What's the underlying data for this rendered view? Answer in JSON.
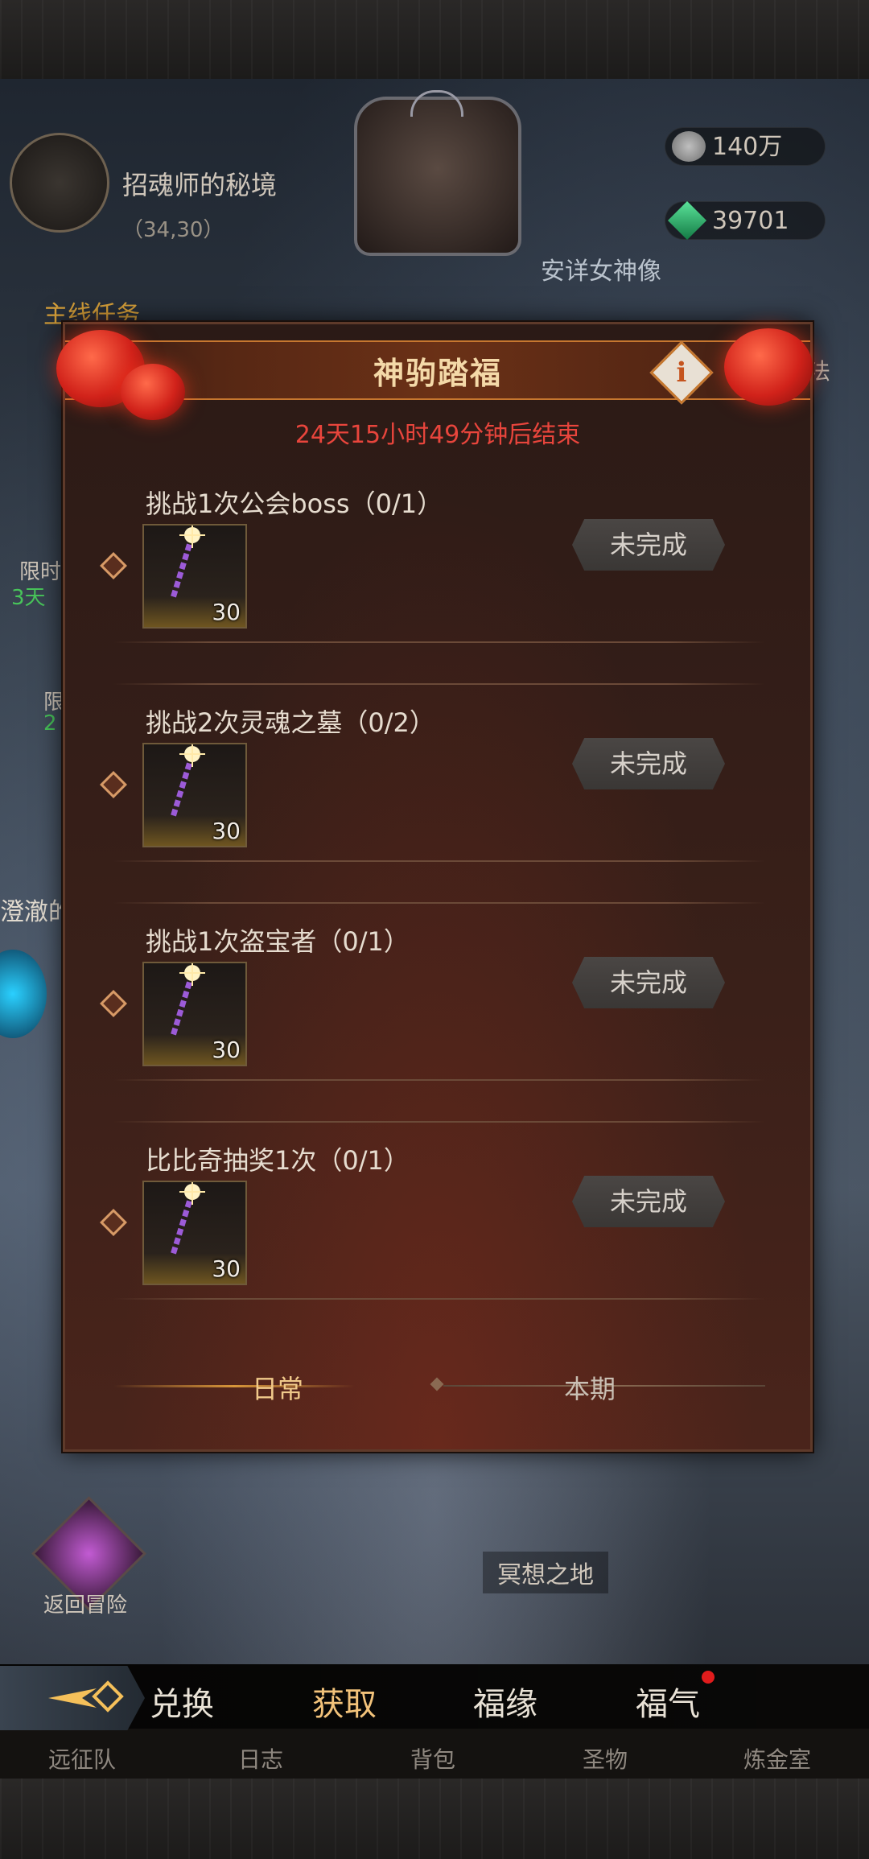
{
  "header": {
    "location_name": "招魂师的秘境",
    "coordinates": "（34,30）",
    "currency_silver": "140万",
    "currency_gem": "39701",
    "statue_label": "安详女神像"
  },
  "left_panel": {
    "quest_title": "主线任务",
    "timer_a": "限时",
    "timer_a_value": "3天",
    "timer_b": "限",
    "timer_b_value": "2",
    "side_text": "澄澈的"
  },
  "right_panel": {
    "side_label": "法"
  },
  "modal": {
    "title": "神驹踏福",
    "countdown": "24天15小时49分钟后结束",
    "info_icon": "i",
    "tasks": [
      {
        "title": "挑战1次公会boss（0/1）",
        "item_count": "30",
        "status": "未完成"
      },
      {
        "title": "挑战2次灵魂之墓（0/2）",
        "item_count": "30",
        "status": "未完成"
      },
      {
        "title": "挑战1次盗宝者（0/1）",
        "item_count": "30",
        "status": "未完成"
      },
      {
        "title": "比比奇抽奖1次（0/1）",
        "item_count": "30",
        "status": "未完成"
      }
    ],
    "tabs": {
      "daily": "日常",
      "period": "本期"
    }
  },
  "map": {
    "return_label": "返回冒险",
    "place_label": "冥想之地"
  },
  "bottom_nav": {
    "main_tabs": [
      "兑换",
      "获取",
      "福缘",
      "福气"
    ],
    "sub_tabs": [
      "远征队",
      "日志",
      "背包",
      "圣物",
      "炼金室"
    ]
  },
  "colors": {
    "accent_gold": "#f4d9a8",
    "countdown_red": "#e8453c",
    "modal_border": "#5e3a2a",
    "notification_red": "#e01c1c"
  }
}
